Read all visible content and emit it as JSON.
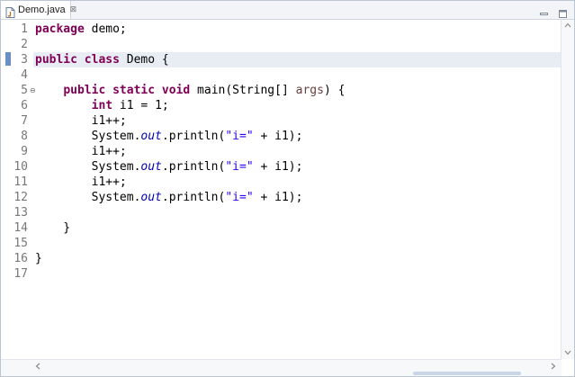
{
  "tab": {
    "title": "Demo.java",
    "close": "⊠",
    "icon": "java-file-icon"
  },
  "window_controls": [
    "minimize-icon",
    "maximize-icon"
  ],
  "colors": {
    "keyword": "#7f0055",
    "string": "#2a00ff",
    "static_field": "#0000c0",
    "parameter": "#6a3e3e",
    "current_line": "#e8edf4"
  },
  "editor": {
    "current_line": 3,
    "fold_marker_line": 5,
    "lines": [
      {
        "n": "1",
        "tokens": [
          {
            "t": "package",
            "c": "kw"
          },
          {
            "t": " demo;"
          }
        ]
      },
      {
        "n": "2",
        "tokens": []
      },
      {
        "n": "3",
        "tokens": [
          {
            "t": "public",
            "c": "kw"
          },
          {
            "t": " "
          },
          {
            "t": "class",
            "c": "kw"
          },
          {
            "t": " Demo {"
          }
        ]
      },
      {
        "n": "4",
        "tokens": []
      },
      {
        "n": "5",
        "tokens": [
          {
            "t": "    "
          },
          {
            "t": "public",
            "c": "kw"
          },
          {
            "t": " "
          },
          {
            "t": "static",
            "c": "kw"
          },
          {
            "t": " "
          },
          {
            "t": "void",
            "c": "kw"
          },
          {
            "t": " main(String[] "
          },
          {
            "t": "args",
            "c": "param"
          },
          {
            "t": ") {"
          }
        ]
      },
      {
        "n": "6",
        "tokens": [
          {
            "t": "        "
          },
          {
            "t": "int",
            "c": "kw"
          },
          {
            "t": " i1 = 1;"
          }
        ]
      },
      {
        "n": "7",
        "tokens": [
          {
            "t": "        i1++;"
          }
        ]
      },
      {
        "n": "8",
        "tokens": [
          {
            "t": "        System."
          },
          {
            "t": "out",
            "c": "fld"
          },
          {
            "t": ".println("
          },
          {
            "t": "\"i=\"",
            "c": "str"
          },
          {
            "t": " + i1);"
          }
        ]
      },
      {
        "n": "9",
        "tokens": [
          {
            "t": "        i1++;"
          }
        ]
      },
      {
        "n": "10",
        "tokens": [
          {
            "t": "        System."
          },
          {
            "t": "out",
            "c": "fld"
          },
          {
            "t": ".println("
          },
          {
            "t": "\"i=\"",
            "c": "str"
          },
          {
            "t": " + i1);"
          }
        ]
      },
      {
        "n": "11",
        "tokens": [
          {
            "t": "        i1++;"
          }
        ]
      },
      {
        "n": "12",
        "tokens": [
          {
            "t": "        System."
          },
          {
            "t": "out",
            "c": "fld"
          },
          {
            "t": ".println("
          },
          {
            "t": "\"i=\"",
            "c": "str"
          },
          {
            "t": " + i1);"
          }
        ]
      },
      {
        "n": "13",
        "tokens": []
      },
      {
        "n": "14",
        "tokens": [
          {
            "t": "    }"
          }
        ]
      },
      {
        "n": "15",
        "tokens": []
      },
      {
        "n": "16",
        "tokens": [
          {
            "t": "}"
          }
        ]
      },
      {
        "n": "17",
        "tokens": []
      }
    ]
  }
}
